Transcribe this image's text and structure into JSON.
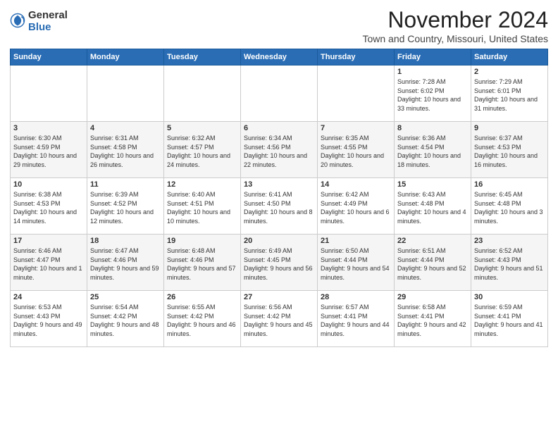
{
  "logo": {
    "general": "General",
    "blue": "Blue"
  },
  "title": "November 2024",
  "location": "Town and Country, Missouri, United States",
  "days_header": [
    "Sunday",
    "Monday",
    "Tuesday",
    "Wednesday",
    "Thursday",
    "Friday",
    "Saturday"
  ],
  "weeks": [
    [
      {
        "day": "",
        "info": ""
      },
      {
        "day": "",
        "info": ""
      },
      {
        "day": "",
        "info": ""
      },
      {
        "day": "",
        "info": ""
      },
      {
        "day": "",
        "info": ""
      },
      {
        "day": "1",
        "info": "Sunrise: 7:28 AM\nSunset: 6:02 PM\nDaylight: 10 hours and 33 minutes."
      },
      {
        "day": "2",
        "info": "Sunrise: 7:29 AM\nSunset: 6:01 PM\nDaylight: 10 hours and 31 minutes."
      }
    ],
    [
      {
        "day": "3",
        "info": "Sunrise: 6:30 AM\nSunset: 4:59 PM\nDaylight: 10 hours and 29 minutes."
      },
      {
        "day": "4",
        "info": "Sunrise: 6:31 AM\nSunset: 4:58 PM\nDaylight: 10 hours and 26 minutes."
      },
      {
        "day": "5",
        "info": "Sunrise: 6:32 AM\nSunset: 4:57 PM\nDaylight: 10 hours and 24 minutes."
      },
      {
        "day": "6",
        "info": "Sunrise: 6:34 AM\nSunset: 4:56 PM\nDaylight: 10 hours and 22 minutes."
      },
      {
        "day": "7",
        "info": "Sunrise: 6:35 AM\nSunset: 4:55 PM\nDaylight: 10 hours and 20 minutes."
      },
      {
        "day": "8",
        "info": "Sunrise: 6:36 AM\nSunset: 4:54 PM\nDaylight: 10 hours and 18 minutes."
      },
      {
        "day": "9",
        "info": "Sunrise: 6:37 AM\nSunset: 4:53 PM\nDaylight: 10 hours and 16 minutes."
      }
    ],
    [
      {
        "day": "10",
        "info": "Sunrise: 6:38 AM\nSunset: 4:53 PM\nDaylight: 10 hours and 14 minutes."
      },
      {
        "day": "11",
        "info": "Sunrise: 6:39 AM\nSunset: 4:52 PM\nDaylight: 10 hours and 12 minutes."
      },
      {
        "day": "12",
        "info": "Sunrise: 6:40 AM\nSunset: 4:51 PM\nDaylight: 10 hours and 10 minutes."
      },
      {
        "day": "13",
        "info": "Sunrise: 6:41 AM\nSunset: 4:50 PM\nDaylight: 10 hours and 8 minutes."
      },
      {
        "day": "14",
        "info": "Sunrise: 6:42 AM\nSunset: 4:49 PM\nDaylight: 10 hours and 6 minutes."
      },
      {
        "day": "15",
        "info": "Sunrise: 6:43 AM\nSunset: 4:48 PM\nDaylight: 10 hours and 4 minutes."
      },
      {
        "day": "16",
        "info": "Sunrise: 6:45 AM\nSunset: 4:48 PM\nDaylight: 10 hours and 3 minutes."
      }
    ],
    [
      {
        "day": "17",
        "info": "Sunrise: 6:46 AM\nSunset: 4:47 PM\nDaylight: 10 hours and 1 minute."
      },
      {
        "day": "18",
        "info": "Sunrise: 6:47 AM\nSunset: 4:46 PM\nDaylight: 9 hours and 59 minutes."
      },
      {
        "day": "19",
        "info": "Sunrise: 6:48 AM\nSunset: 4:46 PM\nDaylight: 9 hours and 57 minutes."
      },
      {
        "day": "20",
        "info": "Sunrise: 6:49 AM\nSunset: 4:45 PM\nDaylight: 9 hours and 56 minutes."
      },
      {
        "day": "21",
        "info": "Sunrise: 6:50 AM\nSunset: 4:44 PM\nDaylight: 9 hours and 54 minutes."
      },
      {
        "day": "22",
        "info": "Sunrise: 6:51 AM\nSunset: 4:44 PM\nDaylight: 9 hours and 52 minutes."
      },
      {
        "day": "23",
        "info": "Sunrise: 6:52 AM\nSunset: 4:43 PM\nDaylight: 9 hours and 51 minutes."
      }
    ],
    [
      {
        "day": "24",
        "info": "Sunrise: 6:53 AM\nSunset: 4:43 PM\nDaylight: 9 hours and 49 minutes."
      },
      {
        "day": "25",
        "info": "Sunrise: 6:54 AM\nSunset: 4:42 PM\nDaylight: 9 hours and 48 minutes."
      },
      {
        "day": "26",
        "info": "Sunrise: 6:55 AM\nSunset: 4:42 PM\nDaylight: 9 hours and 46 minutes."
      },
      {
        "day": "27",
        "info": "Sunrise: 6:56 AM\nSunset: 4:42 PM\nDaylight: 9 hours and 45 minutes."
      },
      {
        "day": "28",
        "info": "Sunrise: 6:57 AM\nSunset: 4:41 PM\nDaylight: 9 hours and 44 minutes."
      },
      {
        "day": "29",
        "info": "Sunrise: 6:58 AM\nSunset: 4:41 PM\nDaylight: 9 hours and 42 minutes."
      },
      {
        "day": "30",
        "info": "Sunrise: 6:59 AM\nSunset: 4:41 PM\nDaylight: 9 hours and 41 minutes."
      }
    ]
  ]
}
